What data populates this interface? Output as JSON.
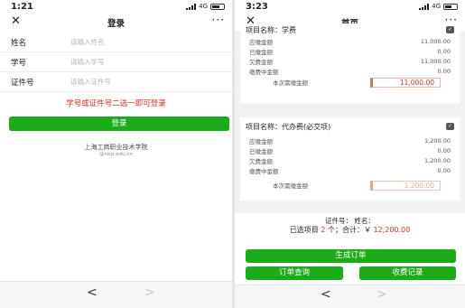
{
  "left": {
    "status": {
      "time": "1:21",
      "network": "4G"
    },
    "nav": {
      "title": "登录",
      "more": "···"
    },
    "form": [
      {
        "label": "姓名",
        "placeholder": "请输入姓名"
      },
      {
        "label": "学号",
        "placeholder": "请输入学号"
      },
      {
        "label": "证件号",
        "placeholder": "请输入证件号"
      }
    ],
    "hint": "学号或证件号二选一即可登录",
    "login_button": "登录",
    "school": "上海工商职业技术学院",
    "email": "@sicp.edu.cn",
    "back": "<",
    "forward": ">"
  },
  "right": {
    "status": {
      "time": "3:23",
      "network": "4G"
    },
    "nav": {
      "title": "首页",
      "more": "···"
    },
    "items": [
      {
        "name": "项目名称：学费",
        "rows": [
          {
            "label": "应缴金额",
            "value": "11,000.00"
          },
          {
            "label": "已缴金额",
            "value": "0.00"
          },
          {
            "label": "欠费金额",
            "value": "11,000.00"
          },
          {
            "label": "缴费中金额",
            "value": "0.00"
          }
        ],
        "pay_label": "本次需缴金额",
        "pay_value": "11,000.00"
      },
      {
        "name": "项目名称：代办费(必交项)",
        "rows": [
          {
            "label": "应缴金额",
            "value": "1,200.00"
          },
          {
            "label": "已缴金额",
            "value": "0.00"
          },
          {
            "label": "欠费金额",
            "value": "1,200.00"
          },
          {
            "label": "缴费中金额",
            "value": "0.00"
          }
        ],
        "pay_label": "本次需缴金额",
        "pay_value": "1,200.00"
      }
    ],
    "student_line": "证件号：                  姓名：",
    "summary_prefix": "已选项目",
    "summary_count": "2",
    "summary_mid": "个；合计：￥",
    "summary_total": "12,200.00",
    "generate_button": "生成订单",
    "query_button": "订单查询",
    "records_button": "收费记录",
    "back": "<",
    "forward": ">"
  },
  "colors": {
    "accent": "#1aad19",
    "warning": "#e03020"
  }
}
